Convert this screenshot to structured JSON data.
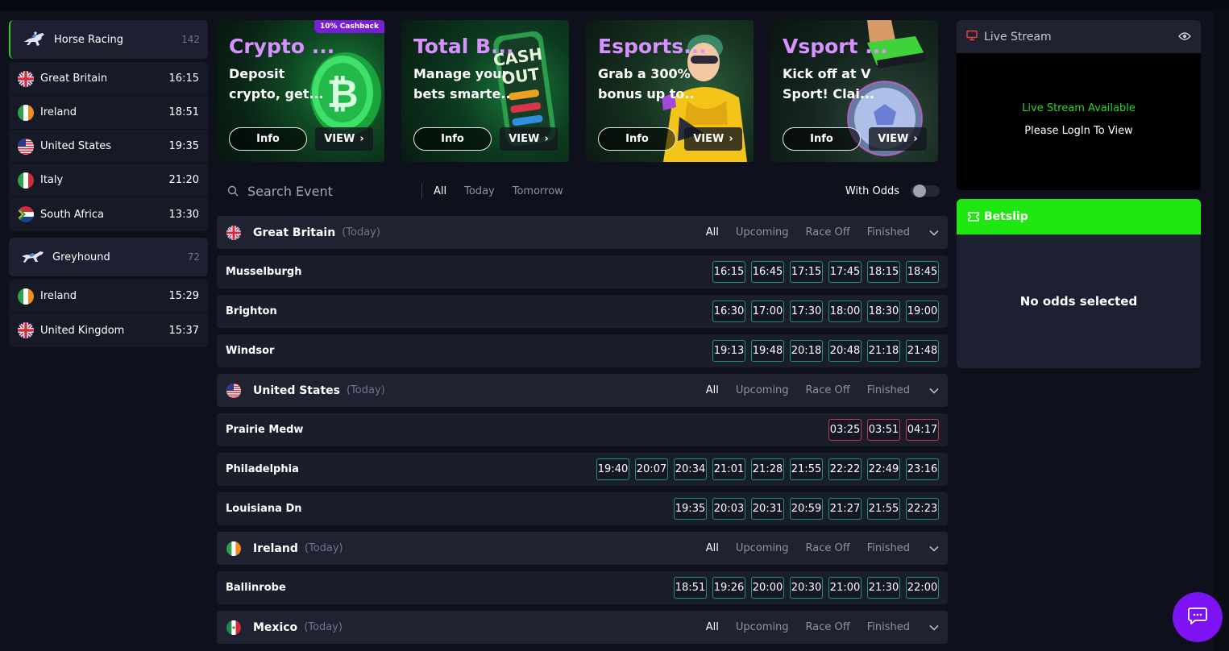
{
  "sidebar": {
    "sports": [
      {
        "name": "Horse Racing",
        "count": "142",
        "icon": "horse-racing-icon",
        "countries": [
          {
            "name": "Great Britain",
            "time": "16:15",
            "flag": "gb"
          },
          {
            "name": "Ireland",
            "time": "18:51",
            "flag": "ie"
          },
          {
            "name": "United States",
            "time": "19:35",
            "flag": "us"
          },
          {
            "name": "Italy",
            "time": "21:20",
            "flag": "it"
          },
          {
            "name": "South Africa",
            "time": "13:30",
            "flag": "za"
          }
        ]
      },
      {
        "name": "Greyhound",
        "count": "72",
        "icon": "greyhound-icon",
        "countries": [
          {
            "name": "Ireland",
            "time": "15:29",
            "flag": "ie"
          },
          {
            "name": "United Kingdom",
            "time": "15:37",
            "flag": "gb"
          }
        ]
      }
    ]
  },
  "promos": [
    {
      "title": "Crypto ...",
      "line1": "Deposit",
      "line2": "crypto, get...",
      "info": "Info",
      "view": "VIEW",
      "badge": "10% Cashback"
    },
    {
      "title": "Total B...",
      "line1": "Manage your",
      "line2": "bets smarte...",
      "info": "Info",
      "view": "VIEW",
      "art_text": "CASH OUT"
    },
    {
      "title": "Esports...",
      "line1": "Grab a 300%",
      "line2": "bonus up to...",
      "info": "Info",
      "view": "VIEW"
    },
    {
      "title": "Vsport ...",
      "line1": "Kick off at V",
      "line2": "Sport! Clai...",
      "info": "Info",
      "view": "VIEW"
    }
  ],
  "filter": {
    "search_placeholder": "Search Event",
    "tabs": [
      "All",
      "Today",
      "Tomorrow"
    ],
    "odds_label": "With Odds"
  },
  "group_filters": [
    "All",
    "Upcoming",
    "Race Off",
    "Finished"
  ],
  "groups": [
    {
      "name": "Great Britain",
      "day": "(Today)",
      "flag": "gb",
      "events": [
        {
          "name": "Musselburgh",
          "times": [
            {
              "t": "16:15"
            },
            {
              "t": "16:45"
            },
            {
              "t": "17:15"
            },
            {
              "t": "17:45"
            },
            {
              "t": "18:15"
            },
            {
              "t": "18:45"
            }
          ]
        },
        {
          "name": "Brighton",
          "times": [
            {
              "t": "16:30"
            },
            {
              "t": "17:00"
            },
            {
              "t": "17:30"
            },
            {
              "t": "18:00"
            },
            {
              "t": "18:30"
            },
            {
              "t": "19:00"
            }
          ]
        },
        {
          "name": "Windsor",
          "times": [
            {
              "t": "19:13"
            },
            {
              "t": "19:48"
            },
            {
              "t": "20:18"
            },
            {
              "t": "20:48"
            },
            {
              "t": "21:18"
            },
            {
              "t": "21:48"
            }
          ]
        }
      ]
    },
    {
      "name": "United States",
      "day": "(Today)",
      "flag": "us",
      "events": [
        {
          "name": "Prairie Medw",
          "times": [
            {
              "t": "03:25",
              "past": true
            },
            {
              "t": "03:51",
              "past": true
            },
            {
              "t": "04:17",
              "past": true
            }
          ]
        },
        {
          "name": "Philadelphia",
          "times": [
            {
              "t": "19:40"
            },
            {
              "t": "20:07"
            },
            {
              "t": "20:34"
            },
            {
              "t": "21:01"
            },
            {
              "t": "21:28"
            },
            {
              "t": "21:55"
            },
            {
              "t": "22:22"
            },
            {
              "t": "22:49"
            },
            {
              "t": "23:16"
            }
          ]
        },
        {
          "name": "Louisiana Dn",
          "times": [
            {
              "t": "19:35"
            },
            {
              "t": "20:03"
            },
            {
              "t": "20:31"
            },
            {
              "t": "20:59"
            },
            {
              "t": "21:27"
            },
            {
              "t": "21:55"
            },
            {
              "t": "22:23"
            }
          ]
        }
      ]
    },
    {
      "name": "Ireland",
      "day": "(Today)",
      "flag": "ie",
      "events": [
        {
          "name": "Ballinrobe",
          "times": [
            {
              "t": "18:51"
            },
            {
              "t": "19:26"
            },
            {
              "t": "20:00"
            },
            {
              "t": "20:30"
            },
            {
              "t": "21:00"
            },
            {
              "t": "21:30"
            },
            {
              "t": "22:00"
            }
          ]
        }
      ]
    },
    {
      "name": "Mexico",
      "day": "(Today)",
      "flag": "mx",
      "events": []
    }
  ],
  "stream": {
    "title": "Live Stream",
    "available": "Live Stream Available",
    "login": "Please LogIn To View"
  },
  "betslip": {
    "title": "Betslip",
    "empty": "No odds selected"
  },
  "colors": {
    "accent_green": "#1ee80f",
    "promo_purple": "#d892ff",
    "time_border": "#1f8f7e",
    "time_border_past": "#c9374a",
    "chat_purple": "#7d12f2"
  }
}
